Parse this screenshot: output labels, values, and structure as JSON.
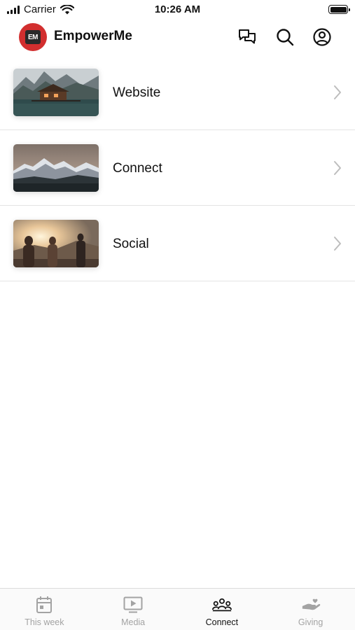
{
  "status_bar": {
    "carrier": "Carrier",
    "time": "10:26 AM"
  },
  "header": {
    "logo_text": "EM",
    "title": "EmpowerMe",
    "icons": [
      "chat-icon",
      "search-icon",
      "account-icon"
    ]
  },
  "list": {
    "items": [
      {
        "label": "Website",
        "thumbnail": "lake-cabin-mountains"
      },
      {
        "label": "Connect",
        "thumbnail": "snowy-mountain-range"
      },
      {
        "label": "Social",
        "thumbnail": "friends-at-sunset"
      }
    ]
  },
  "tab_bar": {
    "tabs": [
      {
        "label": "This week",
        "icon": "calendar-icon",
        "active": false
      },
      {
        "label": "Media",
        "icon": "play-screen-icon",
        "active": false
      },
      {
        "label": "Connect",
        "icon": "group-icon",
        "active": true
      },
      {
        "label": "Giving",
        "icon": "giving-hand-icon",
        "active": false
      }
    ]
  },
  "colors": {
    "brand": "#d22f2f",
    "active_tab": "#111111",
    "inactive_tab": "#a3a3a3"
  }
}
